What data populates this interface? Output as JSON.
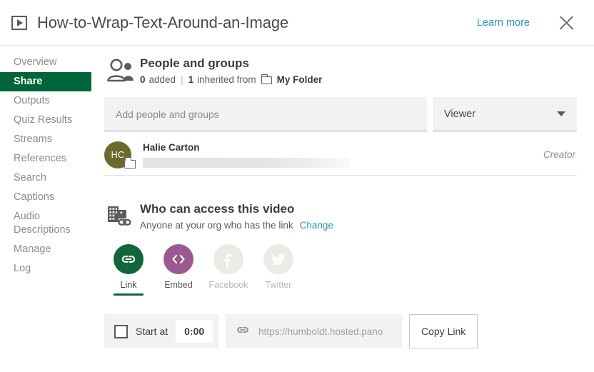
{
  "header": {
    "video_icon": "play-icon",
    "title": "How-to-Wrap-Text-Around-an-Image",
    "learn_more": "Learn more",
    "close_icon": "close-icon"
  },
  "sidebar": {
    "items": [
      {
        "label": "Overview",
        "active": false
      },
      {
        "label": "Share",
        "active": true
      },
      {
        "label": "Outputs",
        "active": false
      },
      {
        "label": "Quiz Results",
        "active": false
      },
      {
        "label": "Streams",
        "active": false
      },
      {
        "label": "References",
        "active": false
      },
      {
        "label": "Search",
        "active": false
      },
      {
        "label": "Captions",
        "active": false
      },
      {
        "label": "Audio\nDescriptions",
        "active": false
      },
      {
        "label": "Manage",
        "active": false
      },
      {
        "label": "Log",
        "active": false
      }
    ],
    "active_bg": "#00653a"
  },
  "people_section": {
    "icon": "people-icon",
    "title": "People and groups",
    "added_count": "0",
    "added_label": "added",
    "separator": "|",
    "inherited_count": "1",
    "inherited_label": "inherited from",
    "folder_icon": "folder-icon",
    "folder_name": "My Folder"
  },
  "add_row": {
    "placeholder": "Add people and groups",
    "value": "",
    "role_value": "Viewer",
    "caret_icon": "chevron-down-icon"
  },
  "person": {
    "initials": "HC",
    "avatar_color": "#6b6b2e",
    "name": "Halie Carton",
    "email_redacted": true,
    "role": "Creator",
    "badge_icon": "folder-icon"
  },
  "access_section": {
    "icon": "building-link-icon",
    "title": "Who can access this video",
    "subtitle": "Anyone at your org who has the link",
    "change_label": "Change"
  },
  "share_targets": [
    {
      "label": "Link",
      "icon": "link-icon",
      "color": "#13663c",
      "state": "active"
    },
    {
      "label": "Embed",
      "icon": "code-icon",
      "color": "#9b5a8f",
      "state": "enabled"
    },
    {
      "label": "Facebook",
      "icon": "facebook-icon",
      "color": "#ebebe6",
      "state": "disabled"
    },
    {
      "label": "Twitter",
      "icon": "twitter-icon",
      "color": "#ebebe6",
      "state": "disabled"
    }
  ],
  "link_row": {
    "start_at_checked": false,
    "start_at_label": "Start at",
    "start_time": "0:00",
    "link_icon": "link-icon",
    "url": "https://humboldt.hosted.pano",
    "copy_label": "Copy Link"
  },
  "colors": {
    "brand_green": "#00653a",
    "link_blue": "#2f8fc0",
    "field_bg": "#f2f2f2"
  }
}
